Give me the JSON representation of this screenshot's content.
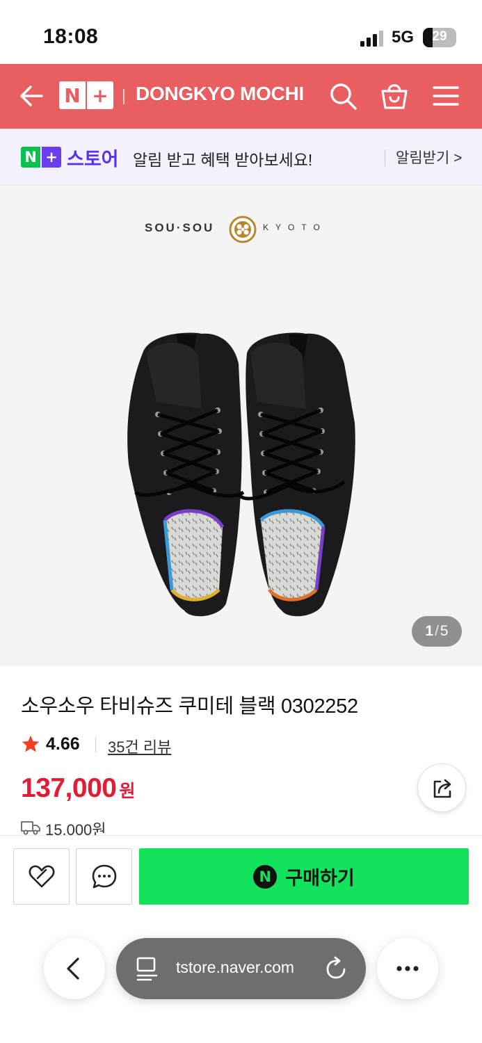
{
  "status_bar": {
    "time": "18:08",
    "network": "5G",
    "battery": "29",
    "battery_level_percent": 29
  },
  "header": {
    "logo_n": "N",
    "logo_plus": "+",
    "store_name": "DONGKYO MOCHI",
    "icons": [
      "back-arrow-icon",
      "search-icon",
      "shopping-bag-icon",
      "menu-icon"
    ],
    "background_color": "#e95e60"
  },
  "notice": {
    "badge_n": "N",
    "badge_plus": "+",
    "store_label": "스토어",
    "message": "알림 받고 혜택 받아보세요!",
    "action": "알림받기 >"
  },
  "product_image": {
    "brand_left": "SOU·SOU",
    "brand_right": "KYOTO",
    "counter_current": "1",
    "counter_sep": "/",
    "counter_total": "5"
  },
  "product": {
    "title": "소우소우 타비슈즈 쿠미테 블랙 0302252",
    "rating": "4.66",
    "reviews": "35건 리뷰",
    "price": "137,000",
    "price_unit": "원",
    "shipping": "15,000원",
    "price_color": "#e21c36"
  },
  "buy_bar": {
    "buy_label": "구매하기",
    "n_mark": "N",
    "buy_color": "#13e35c",
    "icons": [
      "wish-heart-icon",
      "chat-icon",
      "naver-pay-icon"
    ]
  },
  "browser": {
    "url": "tstore.naver.com",
    "icons": [
      "back-chevron-icon",
      "reader-icon",
      "reload-icon",
      "more-icon"
    ]
  }
}
